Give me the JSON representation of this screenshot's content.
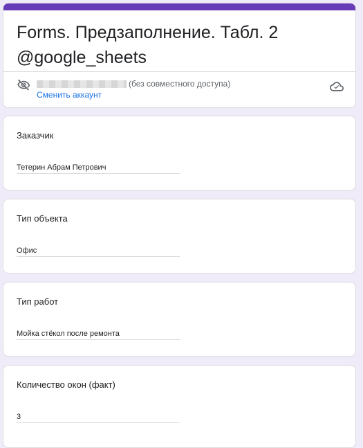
{
  "form": {
    "title": "Forms. Предзаполнение. Табл. 2 @google_sheets",
    "sharing_note": "(без совместного доступа)",
    "switch_account": "Сменить аккаунт",
    "accent_color": "#673ab7",
    "background_color": "#f0ebf8",
    "icons": [
      "eye-off-icon",
      "cloud-icon"
    ]
  },
  "questions": [
    {
      "label": "Заказчик",
      "value": "Тетерин Абрам Петрович"
    },
    {
      "label": "Тип объекта",
      "value": "Офис"
    },
    {
      "label": "Тип работ",
      "value": "Мойка стёкол после ремонта"
    },
    {
      "label": "Количество окон (факт)",
      "value": "3"
    }
  ]
}
